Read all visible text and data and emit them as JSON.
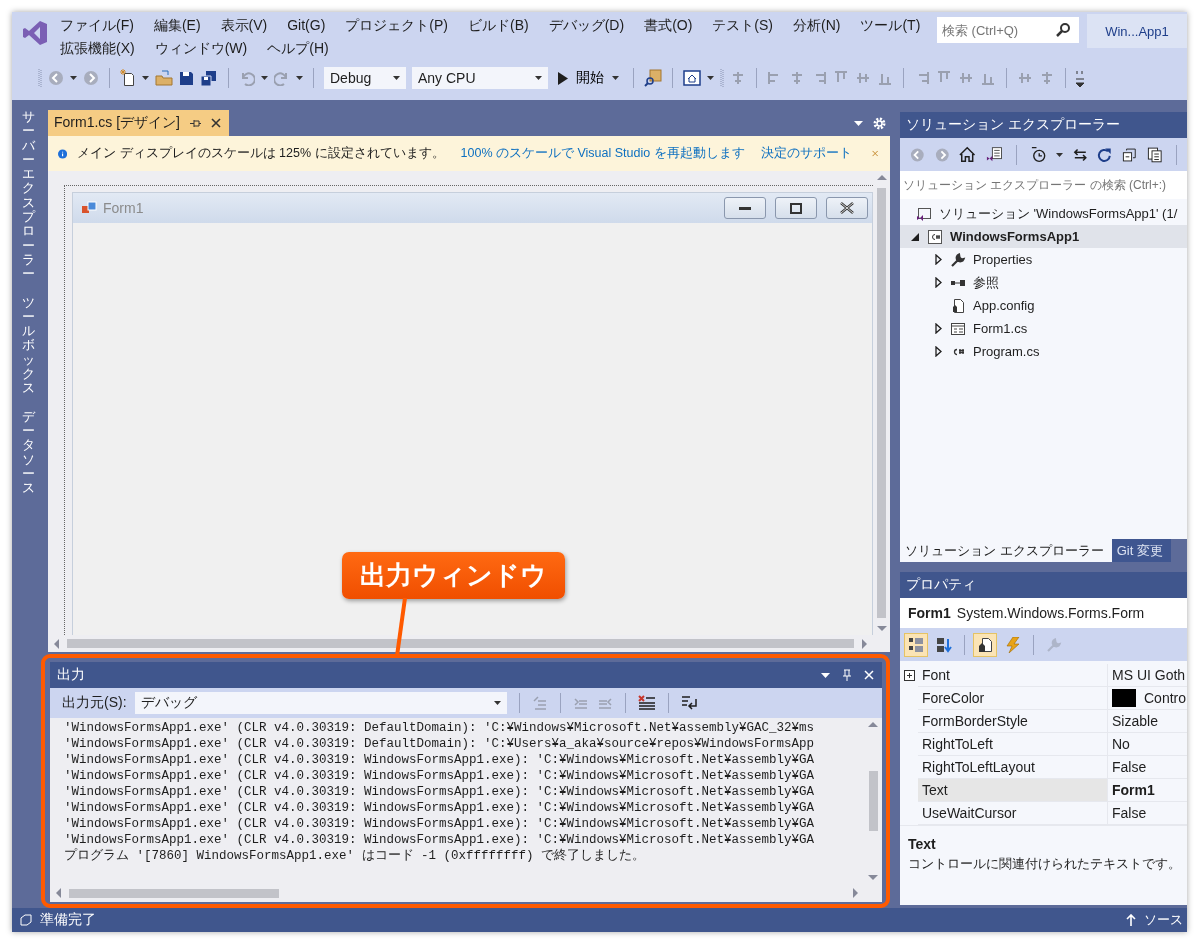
{
  "title_bar": {
    "search_placeholder": "検索 (Ctrl+Q)",
    "solution_name": "Win...App1"
  },
  "menu_rows": [
    [
      "ファイル(F)",
      "編集(E)",
      "表示(V)",
      "Git(G)",
      "プロジェクト(P)",
      "ビルド(B)",
      "デバッグ(D)",
      "書式(O)",
      "テスト(S)",
      "分析(N)",
      "ツール(T)"
    ],
    [
      "拡張機能(X)",
      "ウィンドウ(W)",
      "ヘルプ(H)"
    ]
  ],
  "toolbar": {
    "configuration": "Debug",
    "platform": "Any CPU",
    "start_label": "開始"
  },
  "side_tabs": [
    "サーバーエクスプローラー",
    "ツールボックス",
    "データソース"
  ],
  "document_tabs": [
    {
      "label": "Form1.cs [デザイン]",
      "selected": true
    }
  ],
  "info_bar": {
    "message": "メイン ディスプレイのスケールは 125% に設定されています。",
    "links": [
      "100% のスケールで Visual Studio を再起動します",
      "決定のサポート"
    ]
  },
  "designer": {
    "form_title": "Form1"
  },
  "annotation": {
    "label": "出力ウィンドウ"
  },
  "output": {
    "title": "出力",
    "source_label": "出力元(S):",
    "source": "デバッグ",
    "lines": [
      "'WindowsFormsApp1.exe' (CLR v4.0.30319: DefaultDomain): 'C:¥Windows¥Microsoft.Net¥assembly¥GAC_32¥ms",
      "'WindowsFormsApp1.exe' (CLR v4.0.30319: DefaultDomain): 'C:¥Users¥a_aka¥source¥repos¥WindowsFormsApp",
      "'WindowsFormsApp1.exe' (CLR v4.0.30319: WindowsFormsApp1.exe): 'C:¥Windows¥Microsoft.Net¥assembly¥GA",
      "'WindowsFormsApp1.exe' (CLR v4.0.30319: WindowsFormsApp1.exe): 'C:¥Windows¥Microsoft.Net¥assembly¥GA",
      "'WindowsFormsApp1.exe' (CLR v4.0.30319: WindowsFormsApp1.exe): 'C:¥Windows¥Microsoft.Net¥assembly¥GA",
      "'WindowsFormsApp1.exe' (CLR v4.0.30319: WindowsFormsApp1.exe): 'C:¥Windows¥Microsoft.Net¥assembly¥GA",
      "'WindowsFormsApp1.exe' (CLR v4.0.30319: WindowsFormsApp1.exe): 'C:¥Windows¥Microsoft.Net¥assembly¥GA",
      "'WindowsFormsApp1.exe' (CLR v4.0.30319: WindowsFormsApp1.exe): 'C:¥Windows¥Microsoft.Net¥assembly¥GA",
      "プログラム '[7860] WindowsFormsApp1.exe' はコード -1 (0xffffffff) で終了しました。"
    ]
  },
  "solution_explorer": {
    "title": "ソリューション エクスプローラー",
    "search_placeholder": "ソリューション エクスプローラー の検索 (Ctrl+:)",
    "tree": [
      {
        "label": "ソリューション 'WindowsFormsApp1' (1/",
        "kind": "solution",
        "selected": false,
        "children": [
          {
            "label": "WindowsFormsApp1",
            "kind": "project",
            "expanded": true,
            "selected": true,
            "children": [
              {
                "label": "Properties",
                "kind": "properties",
                "expanded": false,
                "selected": false
              },
              {
                "label": "参照",
                "kind": "references",
                "expanded": false,
                "selected": false
              },
              {
                "label": "App.config",
                "kind": "config",
                "selected": false
              },
              {
                "label": "Form1.cs",
                "kind": "form",
                "expanded": false,
                "selected": false
              },
              {
                "label": "Program.cs",
                "kind": "code",
                "expanded": false,
                "selected": false
              }
            ]
          }
        ]
      }
    ],
    "tabs": [
      {
        "label": "ソリューション エクスプローラー",
        "selected": true
      },
      {
        "label": "Git 変更",
        "selected": false
      }
    ]
  },
  "properties": {
    "title": "プロパティ",
    "object_name": "Form1",
    "object_type": "System.Windows.Forms.Form",
    "toolbar": [
      {
        "kind": "categorized",
        "selected": true,
        "disabled": false
      },
      {
        "kind": "alphabetical",
        "selected": false,
        "disabled": false
      },
      {
        "kind": "properties",
        "selected": true,
        "disabled": false
      },
      {
        "kind": "events",
        "selected": false,
        "disabled": false
      },
      {
        "kind": "pages",
        "selected": false,
        "disabled": true
      }
    ],
    "rows": [
      {
        "name": "Font",
        "value": "MS UI Goth",
        "kind": "group",
        "selected": false,
        "modified": false
      },
      {
        "name": "ForeColor",
        "value": "Contro",
        "kind": "color",
        "color": "#000000",
        "selected": false,
        "modified": false
      },
      {
        "name": "FormBorderStyle",
        "value": "Sizable",
        "kind": "text",
        "selected": false,
        "modified": false
      },
      {
        "name": "RightToLeft",
        "value": "No",
        "kind": "text",
        "selected": false,
        "modified": false
      },
      {
        "name": "RightToLeftLayout",
        "value": "False",
        "kind": "text",
        "selected": false,
        "modified": false
      },
      {
        "name": "Text",
        "value": "Form1",
        "kind": "text",
        "selected": true,
        "modified": true
      },
      {
        "name": "UseWaitCursor",
        "value": "False",
        "kind": "text",
        "selected": false,
        "modified": false
      }
    ],
    "description_title": "Text",
    "description": "コントロールに関連付けられたテキストです。"
  },
  "status_bar": {
    "message": "準備完了",
    "right_label": "ソース"
  }
}
